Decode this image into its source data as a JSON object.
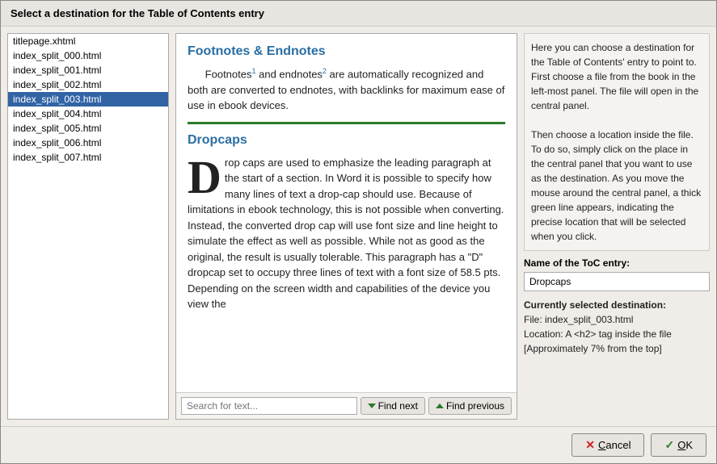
{
  "dialog": {
    "title": "Select a destination for the Table of Contents entry"
  },
  "fileList": {
    "items": [
      {
        "name": "titlepage.xhtml",
        "selected": false
      },
      {
        "name": "index_split_000.html",
        "selected": false
      },
      {
        "name": "index_split_001.html",
        "selected": false
      },
      {
        "name": "index_split_002.html",
        "selected": false
      },
      {
        "name": "index_split_003.html",
        "selected": true
      },
      {
        "name": "index_split_004.html",
        "selected": false
      },
      {
        "name": "index_split_005.html",
        "selected": false
      },
      {
        "name": "index_split_006.html",
        "selected": false
      },
      {
        "name": "index_split_007.html",
        "selected": false
      }
    ]
  },
  "centerContent": {
    "footnotesHeading": "Footnotes & Endnotes",
    "footnotesText": "Footnotes",
    "footnotesSupA": "1",
    "footnotesAnd": " and endnotes",
    "footnotesSupB": "2",
    "footnotesRest": " are automatically recognized and both are converted to endnotes, with backlinks for maximum ease of use in ebook devices.",
    "dropcapsHeading": "Dropcaps",
    "dropcapLetter": "D",
    "dropcapText": "rop caps are used to emphasize the leading paragraph at the start of a section. In Word it is possible to specify how many lines of text a drop-cap should use. Because of limitations in ebook technology, this is not possible when converting. Instead, the converted drop cap will use font size and line height to simulate the effect as well as possible. While not as good as the original, the result is usually tolerable. This paragraph has a \"D\" dropcap set to occupy three lines of text with a font size of 58.5 pts. Depending on the screen width and capabilities of the device you view the"
  },
  "toolbar": {
    "searchPlaceholder": "Search for text...",
    "findNextLabel": "Find next",
    "findPreviousLabel": "Find previous"
  },
  "rightPanel": {
    "helpText": "Here you can choose a destination for the Table of Contents' entry to point to. First choose a file from the book in the left-most panel. The file will open in the central panel.\n\nThen choose a location inside the file. To do so, simply click on the place in the central panel that you want to use as the destination. As you move the mouse around the central panel, a thick green line appears, indicating the precise location that will be selected when you click.",
    "tocNameLabel": "Name of the ToC entry:",
    "tocNameValue": "Dropcaps",
    "currentDestLabel": "Currently selected destination:",
    "currentDestFile": "File: index_split_003.html",
    "currentDestLocation": "Location: A <h2> tag inside the file",
    "currentDestApprox": "[Approximately 7% from the top]"
  },
  "footer": {
    "cancelLabel": "Cancel",
    "cancelUnderline": "C",
    "okLabel": "OK",
    "okUnderline": "O"
  }
}
